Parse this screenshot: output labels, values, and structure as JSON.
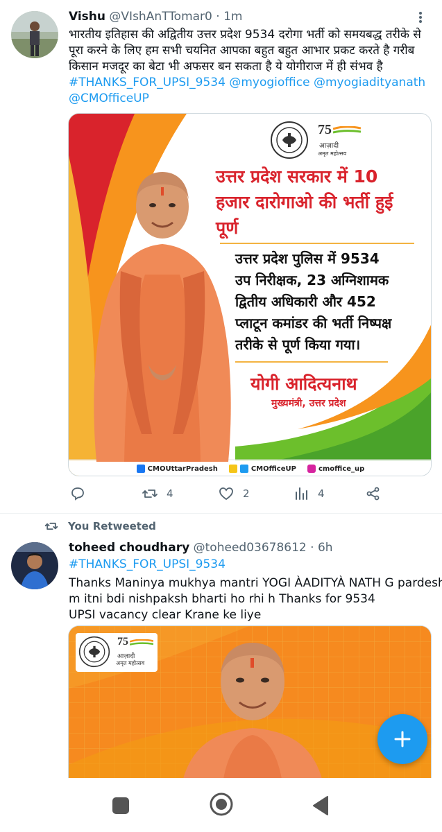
{
  "tweet1": {
    "name": "Vishu",
    "handle": "@VIshAnTTomar0",
    "separator": "·",
    "time": "1m",
    "text_lines": [
      "भारतीय इतिहास की अद्वितीय उत्तर प्रदेश 9534 दरोगा भर्ती को समयबद्ध तरीके से",
      "पूरा करने के लिए हम सभी चयनित आपका बहुत बहुत आभार प्रकट करते है गरीब",
      "किसान मजदूर का बेटा भी अफसर बन सकता है ये योगीराज में ही संभव है"
    ],
    "hashtag": "#THANKS_FOR_UPSI_9534",
    "mentions": [
      "@myogioffice",
      "@myogiadityanath",
      "@CMOfficeUP"
    ],
    "media": {
      "seal_text": "उत्तर प्रदेश सरकार",
      "azadi_number": "75",
      "azadi_line1": "आज़ादी",
      "azadi_line2": "अमृत महोत्सव",
      "headline_lines": [
        "उत्तर प्रदेश सरकार में 10",
        "हजार दारोगाओ की भर्ती हुई",
        "पूर्ण"
      ],
      "body_lines": [
        "उत्तर प्रदेश पुलिस में 9534",
        "उप निरीक्षक, 23 अग्निशामक",
        "द्वितीय अधिकारी और 452",
        "प्लाटून कमांडर की भर्ती निष्पक्ष",
        "तरीके से पूर्ण किया गया।"
      ],
      "signature_name": "योगी आदित्यनाथ",
      "signature_title": "मुख्यमंत्री, उत्तर प्रदेश",
      "footer_items": [
        "CMOUttarPradesh",
        "CMOfficeUP",
        "cmoffice_up"
      ]
    },
    "actions": {
      "reply_count": "",
      "retweet_count": "4",
      "like_count": "2",
      "views_count": "4"
    }
  },
  "retweet_banner": {
    "label": "You Retweeted"
  },
  "tweet2": {
    "name": "toheed choudhary",
    "handle": "@toheed03678612",
    "separator": "·",
    "time": "6h",
    "hashtag": "#THANKS_FOR_UPSI_9534",
    "text_lines": [
      "Thanks Maninya mukhya mantri YOGI ÀADITYÀ NATH G pardesh",
      "m itni bdi nishpaksh bharti ho rhi h Thanks for 9534",
      "UPSI vacancy clear Krane ke liye"
    ],
    "media": {
      "azadi_number": "75",
      "azadi_line1": "आज़ादी",
      "azadi_line2": "अमृत महोत्सव"
    }
  },
  "fab": {
    "icon": "plus-icon"
  },
  "navbar": {
    "icons": [
      "square-icon",
      "home-circle-icon",
      "back-triangle-icon"
    ]
  },
  "colors": {
    "accent": "#1d9bf0",
    "text": "#0f1419",
    "muted": "#536471",
    "poster_red": "#d9232c",
    "poster_orange": "#f7941d",
    "poster_green": "#6cbf2c"
  }
}
